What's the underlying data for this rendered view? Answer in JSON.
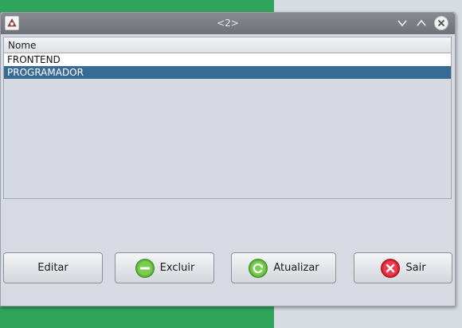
{
  "window": {
    "title": "<2>",
    "controls": [
      "minimize-icon",
      "maximize-icon",
      "close-icon"
    ]
  },
  "table": {
    "columns": [
      "Nome"
    ],
    "rows": [
      "FRONTEND",
      "PROGRAMADOR"
    ],
    "selected_index": 1
  },
  "buttons": {
    "editar": "Editar",
    "excluir": "Excluir",
    "atualizar": "Atualizar",
    "sair": "Sair"
  },
  "colors": {
    "selection": "#376a95",
    "desktop_green": "#2ea55a",
    "excluir_icon": "#5fb43a",
    "atualizar_icon": "#5fb43a",
    "sair_icon": "#e02a3a"
  }
}
